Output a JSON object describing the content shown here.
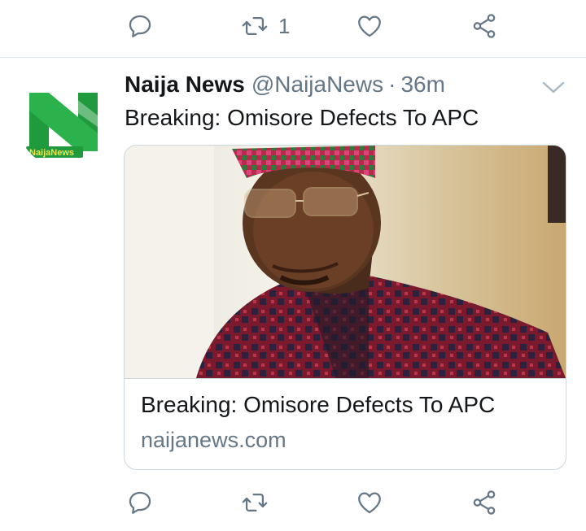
{
  "previous_tweet": {
    "actions": {
      "reply_icon": "reply-icon",
      "retweet_icon": "retweet-icon",
      "retweet_count": "1",
      "like_icon": "heart-icon",
      "share_icon": "share-icon"
    }
  },
  "tweet": {
    "display_name": "Naija News",
    "handle": "@NaijaNews",
    "separator": "·",
    "time": "36m",
    "text": "Breaking: Omisore Defects To APC",
    "avatar_logo_text": "NaijaNews",
    "card": {
      "title": "Breaking: Omisore Defects To APC",
      "domain": "naijanews.com"
    },
    "actions": {
      "reply_icon": "reply-icon",
      "retweet_icon": "retweet-icon",
      "like_icon": "heart-icon",
      "share_icon": "share-icon"
    }
  },
  "colors": {
    "text_primary": "#14171a",
    "text_secondary": "#657786",
    "border": "#ccd6dd",
    "brand_green": "#1f9a3c"
  }
}
